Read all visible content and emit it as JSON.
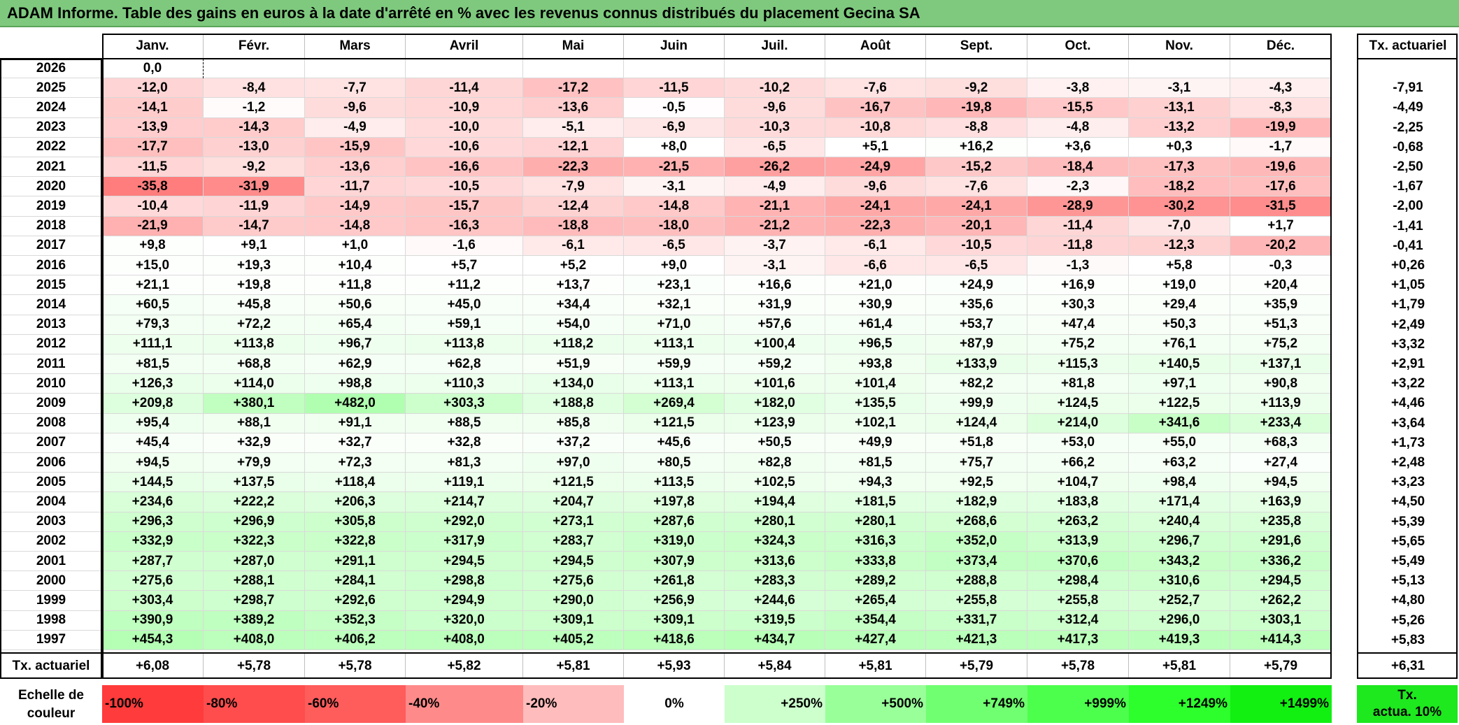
{
  "title": "ADAM Informe. Table des gains en euros à la date d'arrêté en % avec les revenus connus distribués du placement Gecina SA",
  "months": [
    "Janv.",
    "Févr.",
    "Mars",
    "Avril",
    "Mai",
    "Juin",
    "Juil.",
    "Août",
    "Sept.",
    "Oct.",
    "Nov.",
    "Déc."
  ],
  "rate_header": "Tx. actuariel",
  "rows": [
    {
      "year": "2026",
      "values": [
        "0,0",
        "",
        "",
        "",
        "",
        "",
        "",
        "",
        "",
        "",
        "",
        ""
      ],
      "rate": ""
    },
    {
      "year": "2025",
      "values": [
        "-12,0",
        "-8,4",
        "-7,7",
        "-11,4",
        "-17,2",
        "-11,5",
        "-10,2",
        "-7,6",
        "-9,2",
        "-3,8",
        "-3,1",
        "-4,3"
      ],
      "rate": "-7,91"
    },
    {
      "year": "2024",
      "values": [
        "-14,1",
        "-1,2",
        "-9,6",
        "-10,9",
        "-13,6",
        "-0,5",
        "-9,6",
        "-16,7",
        "-19,8",
        "-15,5",
        "-13,1",
        "-8,3"
      ],
      "rate": "-4,49"
    },
    {
      "year": "2023",
      "values": [
        "-13,9",
        "-14,3",
        "-4,9",
        "-10,0",
        "-5,1",
        "-6,9",
        "-10,3",
        "-10,8",
        "-8,8",
        "-4,8",
        "-13,2",
        "-19,9"
      ],
      "rate": "-2,25"
    },
    {
      "year": "2022",
      "values": [
        "-17,7",
        "-13,0",
        "-15,9",
        "-10,6",
        "-12,1",
        "+8,0",
        "-6,5",
        "+5,1",
        "+16,2",
        "+3,6",
        "+0,3",
        "-1,7"
      ],
      "rate": "-0,68"
    },
    {
      "year": "2021",
      "values": [
        "-11,5",
        "-9,2",
        "-13,6",
        "-16,6",
        "-22,3",
        "-21,5",
        "-26,2",
        "-24,9",
        "-15,2",
        "-18,4",
        "-17,3",
        "-19,6"
      ],
      "rate": "-2,50"
    },
    {
      "year": "2020",
      "values": [
        "-35,8",
        "-31,9",
        "-11,7",
        "-10,5",
        "-7,9",
        "-3,1",
        "-4,9",
        "-9,6",
        "-7,6",
        "-2,3",
        "-18,2",
        "-17,6"
      ],
      "rate": "-1,67"
    },
    {
      "year": "2019",
      "values": [
        "-10,4",
        "-11,9",
        "-14,9",
        "-15,7",
        "-12,4",
        "-14,8",
        "-21,1",
        "-24,1",
        "-24,1",
        "-28,9",
        "-30,2",
        "-31,5"
      ],
      "rate": "-2,00"
    },
    {
      "year": "2018",
      "values": [
        "-21,9",
        "-14,7",
        "-14,8",
        "-16,3",
        "-18,8",
        "-18,0",
        "-21,2",
        "-22,3",
        "-20,1",
        "-11,4",
        "-7,0",
        "+1,7"
      ],
      "rate": "-1,41"
    },
    {
      "year": "2017",
      "values": [
        "+9,8",
        "+9,1",
        "+1,0",
        "-1,6",
        "-6,1",
        "-6,5",
        "-3,7",
        "-6,1",
        "-10,5",
        "-11,8",
        "-12,3",
        "-20,2"
      ],
      "rate": "-0,41"
    },
    {
      "year": "2016",
      "values": [
        "+15,0",
        "+19,3",
        "+10,4",
        "+5,7",
        "+5,2",
        "+9,0",
        "-3,1",
        "-6,6",
        "-6,5",
        "-1,3",
        "+5,8",
        "-0,3"
      ],
      "rate": "+0,26"
    },
    {
      "year": "2015",
      "values": [
        "+21,1",
        "+19,8",
        "+11,8",
        "+11,2",
        "+13,7",
        "+23,1",
        "+16,6",
        "+21,0",
        "+24,9",
        "+16,9",
        "+19,0",
        "+20,4"
      ],
      "rate": "+1,05"
    },
    {
      "year": "2014",
      "values": [
        "+60,5",
        "+45,8",
        "+50,6",
        "+45,0",
        "+34,4",
        "+32,1",
        "+31,9",
        "+30,9",
        "+35,6",
        "+30,3",
        "+29,4",
        "+35,9"
      ],
      "rate": "+1,79"
    },
    {
      "year": "2013",
      "values": [
        "+79,3",
        "+72,2",
        "+65,4",
        "+59,1",
        "+54,0",
        "+71,0",
        "+57,6",
        "+61,4",
        "+53,7",
        "+47,4",
        "+50,3",
        "+51,3"
      ],
      "rate": "+2,49"
    },
    {
      "year": "2012",
      "values": [
        "+111,1",
        "+113,8",
        "+96,7",
        "+113,8",
        "+118,2",
        "+113,1",
        "+100,4",
        "+96,5",
        "+87,9",
        "+75,2",
        "+76,1",
        "+75,2"
      ],
      "rate": "+3,32"
    },
    {
      "year": "2011",
      "values": [
        "+81,5",
        "+68,8",
        "+62,9",
        "+62,8",
        "+51,9",
        "+59,9",
        "+59,2",
        "+93,8",
        "+133,9",
        "+115,3",
        "+140,5",
        "+137,1"
      ],
      "rate": "+2,91"
    },
    {
      "year": "2010",
      "values": [
        "+126,3",
        "+114,0",
        "+98,8",
        "+110,3",
        "+134,0",
        "+113,1",
        "+101,6",
        "+101,4",
        "+82,2",
        "+81,8",
        "+97,1",
        "+90,8"
      ],
      "rate": "+3,22"
    },
    {
      "year": "2009",
      "values": [
        "+209,8",
        "+380,1",
        "+482,0",
        "+303,3",
        "+188,8",
        "+269,4",
        "+182,0",
        "+135,5",
        "+99,9",
        "+124,5",
        "+122,5",
        "+113,9"
      ],
      "rate": "+4,46"
    },
    {
      "year": "2008",
      "values": [
        "+95,4",
        "+88,1",
        "+91,1",
        "+88,5",
        "+85,8",
        "+121,5",
        "+123,9",
        "+102,1",
        "+124,4",
        "+214,0",
        "+341,6",
        "+233,4"
      ],
      "rate": "+3,64"
    },
    {
      "year": "2007",
      "values": [
        "+45,4",
        "+32,9",
        "+32,7",
        "+32,8",
        "+37,2",
        "+45,6",
        "+50,5",
        "+49,9",
        "+51,8",
        "+53,0",
        "+55,0",
        "+68,3"
      ],
      "rate": "+1,73"
    },
    {
      "year": "2006",
      "values": [
        "+94,5",
        "+79,9",
        "+72,3",
        "+81,3",
        "+97,0",
        "+80,5",
        "+82,8",
        "+81,5",
        "+75,7",
        "+66,2",
        "+63,2",
        "+27,4"
      ],
      "rate": "+2,48"
    },
    {
      "year": "2005",
      "values": [
        "+144,5",
        "+137,5",
        "+118,4",
        "+119,1",
        "+121,5",
        "+113,5",
        "+102,5",
        "+94,3",
        "+92,5",
        "+104,7",
        "+98,4",
        "+94,5"
      ],
      "rate": "+3,23"
    },
    {
      "year": "2004",
      "values": [
        "+234,6",
        "+222,2",
        "+206,3",
        "+214,7",
        "+204,7",
        "+197,8",
        "+194,4",
        "+181,5",
        "+182,9",
        "+183,8",
        "+171,4",
        "+163,9"
      ],
      "rate": "+4,50"
    },
    {
      "year": "2003",
      "values": [
        "+296,3",
        "+296,9",
        "+305,8",
        "+292,0",
        "+273,1",
        "+287,6",
        "+280,1",
        "+280,1",
        "+268,6",
        "+263,2",
        "+240,4",
        "+235,8"
      ],
      "rate": "+5,39"
    },
    {
      "year": "2002",
      "values": [
        "+332,9",
        "+322,3",
        "+322,8",
        "+317,9",
        "+283,7",
        "+319,0",
        "+324,3",
        "+316,3",
        "+352,0",
        "+313,9",
        "+296,7",
        "+291,6"
      ],
      "rate": "+5,65"
    },
    {
      "year": "2001",
      "values": [
        "+287,7",
        "+287,0",
        "+291,1",
        "+294,5",
        "+294,5",
        "+307,9",
        "+313,6",
        "+333,8",
        "+373,4",
        "+370,6",
        "+343,2",
        "+336,2"
      ],
      "rate": "+5,49"
    },
    {
      "year": "2000",
      "values": [
        "+275,6",
        "+288,1",
        "+284,1",
        "+298,8",
        "+275,6",
        "+261,8",
        "+283,3",
        "+289,2",
        "+288,8",
        "+298,4",
        "+310,6",
        "+294,5"
      ],
      "rate": "+5,13"
    },
    {
      "year": "1999",
      "values": [
        "+303,4",
        "+298,7",
        "+292,6",
        "+294,9",
        "+290,0",
        "+256,9",
        "+244,6",
        "+265,4",
        "+255,8",
        "+255,8",
        "+252,7",
        "+262,2"
      ],
      "rate": "+4,80"
    },
    {
      "year": "1998",
      "values": [
        "+390,9",
        "+389,2",
        "+352,3",
        "+320,0",
        "+309,1",
        "+309,1",
        "+319,5",
        "+354,4",
        "+331,7",
        "+312,4",
        "+296,0",
        "+303,1"
      ],
      "rate": "+5,26"
    },
    {
      "year": "1997",
      "values": [
        "+454,3",
        "+408,0",
        "+406,2",
        "+408,0",
        "+405,2",
        "+418,6",
        "+434,7",
        "+427,4",
        "+421,3",
        "+417,3",
        "+419,3",
        "+414,3"
      ],
      "rate": "+5,83"
    }
  ],
  "footer": {
    "label": "Tx. actuariel",
    "values": [
      "+6,08",
      "+5,78",
      "+5,78",
      "+5,82",
      "+5,81",
      "+5,93",
      "+5,84",
      "+5,81",
      "+5,79",
      "+5,78",
      "+5,81",
      "+5,79"
    ],
    "rate": "+6,31"
  },
  "legend": {
    "label_line1": "Echelle de",
    "label_line2": "couleur",
    "items": [
      {
        "text": "-100%",
        "color": "#ff3b3b",
        "align": "left"
      },
      {
        "text": "-80%",
        "color": "#ff4d4d",
        "align": "left"
      },
      {
        "text": "-60%",
        "color": "#ff5c5c",
        "align": "left"
      },
      {
        "text": "-40%",
        "color": "#ff8a8a",
        "align": "left"
      },
      {
        "text": "-20%",
        "color": "#ffbcbc",
        "align": "left"
      },
      {
        "text": "0%",
        "color": "#ffffff",
        "align": "center"
      },
      {
        "text": "+250%",
        "color": "#ccffcc",
        "align": "right"
      },
      {
        "text": "+500%",
        "color": "#99ff99",
        "align": "right"
      },
      {
        "text": "+749%",
        "color": "#70ff70",
        "align": "right"
      },
      {
        "text": "+999%",
        "color": "#4dff4d",
        "align": "right"
      },
      {
        "text": "+1249%",
        "color": "#2cff2c",
        "align": "right"
      },
      {
        "text": "+1499%",
        "color": "#12f012",
        "align": "right"
      }
    ],
    "rate_line1": "Tx.",
    "rate_line2": "actua. 10%",
    "rate_color": "#1ee81e"
  },
  "colors": {
    "title_bg": "#7ec97e",
    "negative_max": "#ff3b3b",
    "positive_max": "#12f012"
  }
}
